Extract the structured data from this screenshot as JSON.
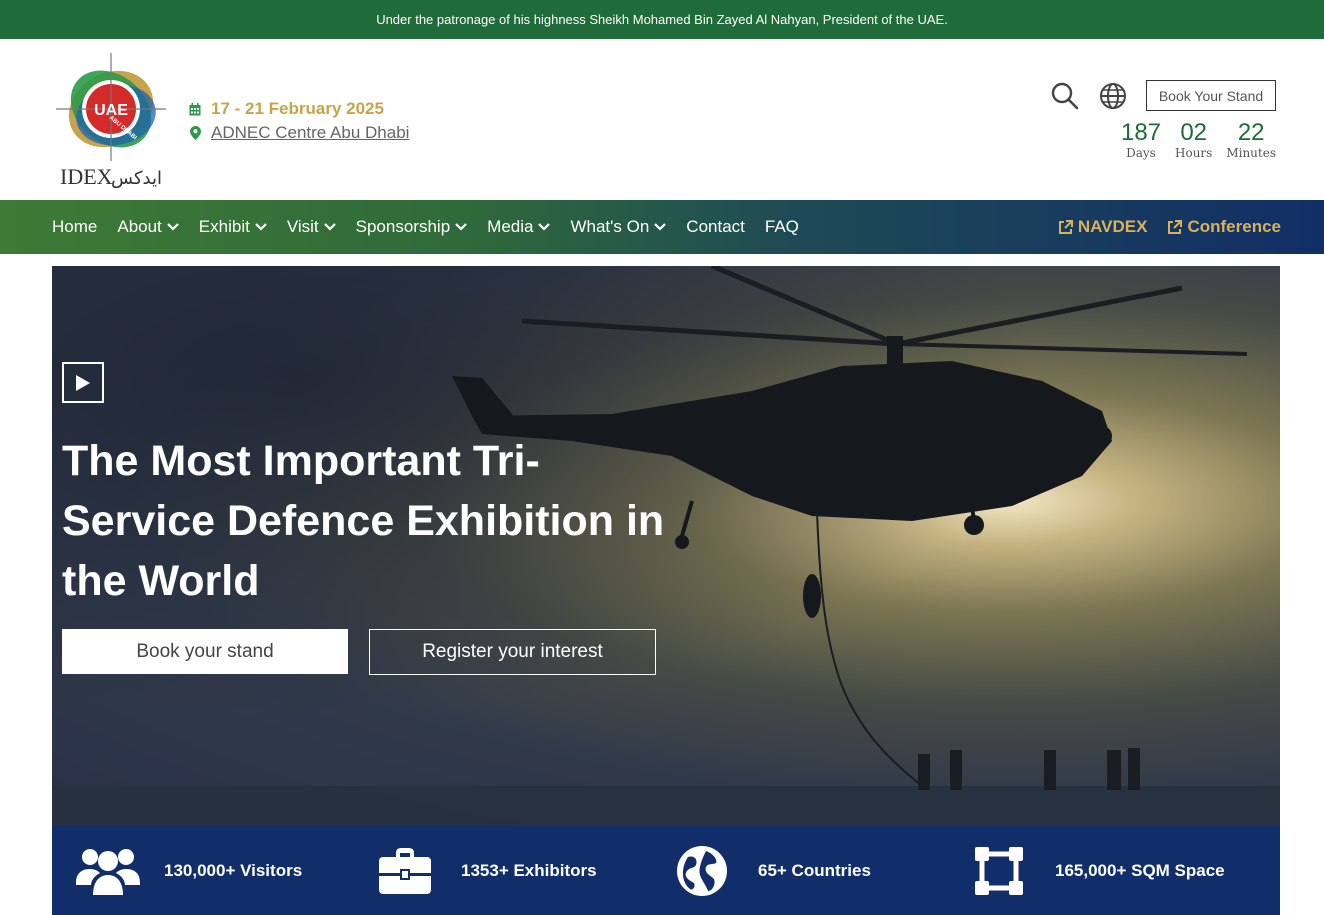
{
  "topbar": {
    "text": "Under the patronage of his highness Sheikh Mohamed Bin Zayed Al Nahyan, President of the UAE."
  },
  "logo": {
    "badge": "UAE",
    "ring": "ABU DHABI",
    "wordmark": "IDEX",
    "arabic": "ايدكس"
  },
  "event": {
    "dates": "17 - 21 February 2025",
    "venue": "ADNEC Centre Abu Dhabi"
  },
  "header": {
    "book_stand": "Book Your Stand",
    "countdown": [
      {
        "value": "187",
        "label": "Days"
      },
      {
        "value": "02",
        "label": "Hours"
      },
      {
        "value": "22",
        "label": "Minutes"
      }
    ]
  },
  "nav": {
    "items": [
      {
        "label": "Home",
        "dropdown": false
      },
      {
        "label": "About",
        "dropdown": true
      },
      {
        "label": "Exhibit",
        "dropdown": true
      },
      {
        "label": "Visit",
        "dropdown": true
      },
      {
        "label": "Sponsorship",
        "dropdown": true
      },
      {
        "label": "Media",
        "dropdown": true
      },
      {
        "label": "What's On",
        "dropdown": true
      },
      {
        "label": "Contact",
        "dropdown": false
      },
      {
        "label": "FAQ",
        "dropdown": false
      }
    ],
    "external": [
      {
        "label": "NAVDEX"
      },
      {
        "label": "Conference"
      }
    ]
  },
  "hero": {
    "title": "The Most Important Tri-Service Defence Exhibition in the World",
    "book_btn": "Book your stand",
    "register_btn": "Register your interest"
  },
  "stats": [
    {
      "icon": "users-icon",
      "label": "130,000+ Visitors"
    },
    {
      "icon": "briefcase-icon",
      "label": "1353+ Exhibitors"
    },
    {
      "icon": "globe-icon",
      "label": "65+ Countries"
    },
    {
      "icon": "vector-square-icon",
      "label": "165,000+ SQM Space"
    }
  ],
  "colors": {
    "green": "#1f6b3a",
    "gold": "#c9a34a",
    "navy": "#122e6a"
  }
}
